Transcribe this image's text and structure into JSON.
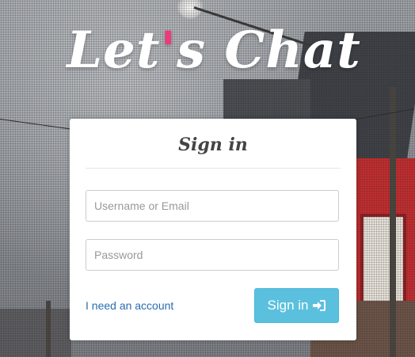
{
  "logo": {
    "text_before": "Let",
    "apostrophe": "'",
    "text_after": "s Chat"
  },
  "signin_card": {
    "title": "Sign in",
    "username_placeholder": "Username or Email",
    "password_placeholder": "Password",
    "register_link": "I need an account",
    "submit_label": "Sign in",
    "submit_icon": "sign-in-icon"
  },
  "colors": {
    "accent_pink": "#ec3a7b",
    "button_bg": "#5bc0de",
    "link": "#2a6db0"
  }
}
